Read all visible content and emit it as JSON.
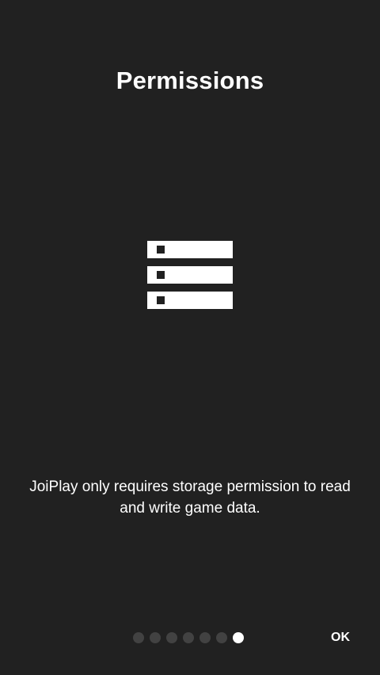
{
  "onboarding": {
    "title": "Permissions",
    "description": "JoiPlay only requires storage permission to read and write game data.",
    "icon": "storage-icon",
    "pager": {
      "total": 7,
      "active_index": 6
    },
    "ok_label": "OK"
  },
  "colors": {
    "background": "#212121",
    "text": "#ffffff",
    "dot_inactive": "#424242",
    "dot_active": "#ffffff"
  }
}
